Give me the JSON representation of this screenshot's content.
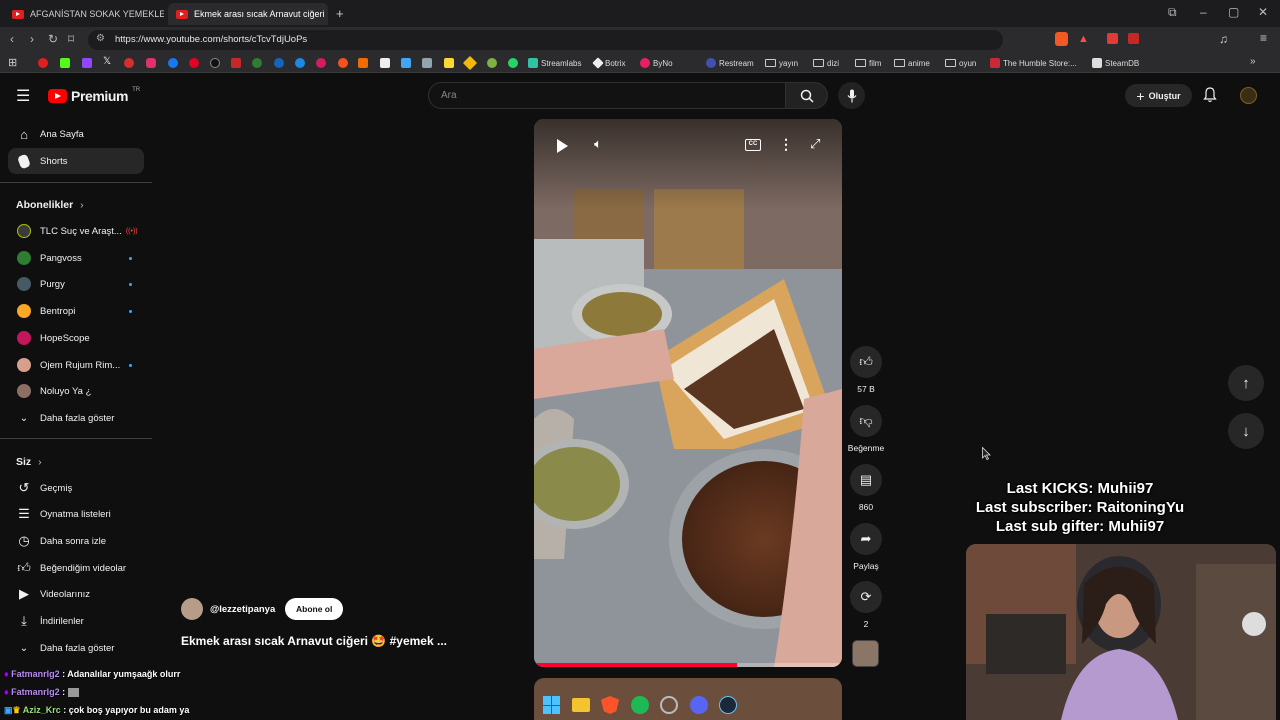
{
  "browser": {
    "tabs": [
      {
        "label": "AFGANİSTAN SOKAK YEMEKLERİNE"
      },
      {
        "label": "Ekmek arası sıcak Arnavut ciğeri"
      }
    ],
    "new_tab": "+",
    "url": "https://www.youtube.com/shorts/cTcvTdjUoPs",
    "bookmarks": [
      {
        "label": "Streamlabs"
      },
      {
        "label": "Botrix"
      },
      {
        "label": "ByNo"
      },
      {
        "label": "Restream"
      },
      {
        "label": "yayın"
      },
      {
        "label": "dizi"
      },
      {
        "label": "film"
      },
      {
        "label": "anime"
      },
      {
        "label": "oyun"
      },
      {
        "label": "The Humble Store:..."
      },
      {
        "label": "SteamDB"
      }
    ]
  },
  "header": {
    "logo": "Premium",
    "region": "TR",
    "search_placeholder": "Ara",
    "create_label": "Oluştur"
  },
  "sidebar": {
    "main": [
      {
        "label": "Ana Sayfa",
        "icon": "home-icon"
      },
      {
        "label": "Shorts",
        "icon": "shorts-icon"
      }
    ],
    "subs_title": "Abonelikler",
    "subs": [
      {
        "label": "TLC Suç ve Araşt...",
        "color": "#3b3b3b"
      },
      {
        "label": "Pangvoss",
        "color": "#2e7d32"
      },
      {
        "label": "Purgy",
        "color": "#455a64"
      },
      {
        "label": "Bentropi",
        "color": "#f9a825"
      },
      {
        "label": "HopeScope",
        "color": "#c2185b"
      },
      {
        "label": "Ojem Rujum Rim...",
        "color": "#d7a08a"
      },
      {
        "label": "Noluyo Ya ¿",
        "color": "#8d6e63"
      }
    ],
    "subs_more": "Daha fazla göster",
    "you_title": "Siz",
    "you": [
      {
        "label": "Geçmiş",
        "icon": "history-icon"
      },
      {
        "label": "Oynatma listeleri",
        "icon": "playlists-icon"
      },
      {
        "label": "Daha sonra izle",
        "icon": "watch-later-icon"
      },
      {
        "label": "Beğendiğim videolar",
        "icon": "liked-icon"
      },
      {
        "label": "Videolarınız",
        "icon": "your-videos-icon"
      },
      {
        "label": "İndirilenler",
        "icon": "downloads-icon"
      }
    ],
    "you_more": "Daha fazla göster"
  },
  "short": {
    "channel": "@lezzetipanya",
    "subscribe": "Abone ol",
    "title": "Ekmek arası sıcak Arnavut ciğeri 🤩 #yemek ...",
    "progress": 0.66
  },
  "actions": {
    "like_count": "57 B",
    "dislike_label": "Beğenme",
    "comment_count": "860",
    "share_label": "Paylaş",
    "remix_count": "2"
  },
  "stream_overlay": {
    "line1": "Last KICKS: Muhii97",
    "line2": "Last subscriber: RaitoningYu",
    "line3": "Last sub gifter: Muhii97"
  },
  "chat": [
    {
      "name": "Fatmanrlg2",
      "msg": ": Adanalılar yumşaağk olurr"
    },
    {
      "name": "Fatmanrlg2",
      "msg": ":"
    },
    {
      "name": "Aziz_Krc",
      "msg": ": çok boş yapıyor bu adam ya"
    }
  ],
  "colors": {
    "bg": "#0f0f0f",
    "accent_red": "#ff0000",
    "chat_name": "#b48cf0",
    "link_blue": "#3ea6ff"
  }
}
